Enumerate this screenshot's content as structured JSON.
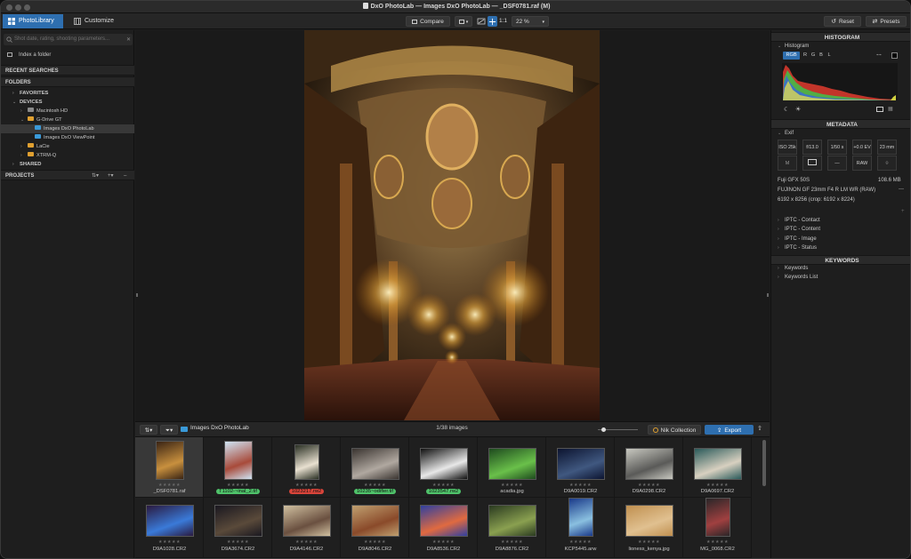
{
  "window": {
    "title": "DxO PhotoLab — Images DxO PhotoLab — _DSF0781.raf (M)"
  },
  "toolbar": {
    "tab_photolibrary": "PhotoLibrary",
    "tab_customize": "Customize",
    "compare_label": "Compare",
    "ratio_label": "1:1",
    "zoom_value": "22 %",
    "reset_label": "Reset",
    "presets_label": "Presets"
  },
  "left": {
    "search_placeholder": "Shot date, rating, shooting parameters...",
    "index_folder": "Index a folder",
    "recent_searches": "RECENT SEARCHES",
    "folders": "FOLDERS",
    "favorites": "FAVORITES",
    "devices": "DEVICES",
    "macintosh_hd": "Macintosh HD",
    "gdrive": "G-Drive GT",
    "images_photolab": "Images DxO PhotoLab",
    "images_viewpoint": "Images DxO ViewPoint",
    "lacie": "LaCie",
    "xtrmq": "XTRM-Q",
    "shared": "SHARED",
    "projects": "PROJECTS"
  },
  "strip": {
    "folder_label": "Images DxO PhotoLab",
    "count_label": "1/38 images",
    "nik_label": "Nik Collection",
    "export_label": "Export",
    "zoom_fraction": 0.1,
    "thumbs": [
      {
        "name": "_DSF0781.raf",
        "tag": "",
        "selected": true
      },
      {
        "name": "T1102-~inal_2.tif",
        "tag": "#4fc26a",
        "selected": false
      },
      {
        "name": "1023217.rw2",
        "tag": "#d8443a",
        "selected": false
      },
      {
        "name": "10235~odifier.tif",
        "tag": "#4fc26a",
        "selected": false
      },
      {
        "name": "1023547.rw2",
        "tag": "#4fc26a",
        "selected": false
      },
      {
        "name": "acadia.jpg",
        "tag": "",
        "selected": false
      },
      {
        "name": "D9A0019.CR2",
        "tag": "",
        "selected": false
      },
      {
        "name": "D9A0298.CR2",
        "tag": "",
        "selected": false
      },
      {
        "name": "D9A0697.CR2",
        "tag": "",
        "selected": false
      },
      {
        "name": "D9A1028.CR2",
        "tag": "",
        "selected": false
      },
      {
        "name": "D9A3674.CR2",
        "tag": "",
        "selected": false
      },
      {
        "name": "D9A4146.CR2",
        "tag": "",
        "selected": false
      },
      {
        "name": "D9A8046.CR2",
        "tag": "",
        "selected": false
      },
      {
        "name": "D9A8536.CR2",
        "tag": "",
        "selected": false
      },
      {
        "name": "D9A8876.CR2",
        "tag": "",
        "selected": false
      },
      {
        "name": "KCP5445.arw",
        "tag": "",
        "selected": false
      },
      {
        "name": "lioness_kenya.jpg",
        "tag": "",
        "selected": false
      },
      {
        "name": "MG_0068.CR2",
        "tag": "",
        "selected": false
      }
    ]
  },
  "right": {
    "histogram_header": "HISTOGRAM",
    "histogram_label": "Histogram",
    "ch_rgb": "RGB",
    "ch_r": "R",
    "ch_g": "G",
    "ch_b": "B",
    "ch_l": "L",
    "metadata_header": "METADATA",
    "exif_label": "Exif",
    "iso": "ISO 25k",
    "aperture": "f/13.0",
    "shutter": "1/50 s",
    "ev": "+0.0 EV",
    "focal": "23 mm",
    "mode": "M",
    "flash": "—",
    "format": "RAW",
    "camera": "Fuji GFX 50S",
    "size_mb": "108.6 MB",
    "lens": "FUJINON GF 23mm F4 R LM WR (RAW)",
    "dimensions": "6192 x 8256 (crop: 6192 x 8224)",
    "iptc_contact": "IPTC - Contact",
    "iptc_content": "IPTC - Content",
    "iptc_image": "IPTC - Image",
    "iptc_status": "IPTC - Status",
    "keywords_header": "KEYWORDS",
    "keywords": "Keywords",
    "keywords_list": "Keywords List"
  }
}
